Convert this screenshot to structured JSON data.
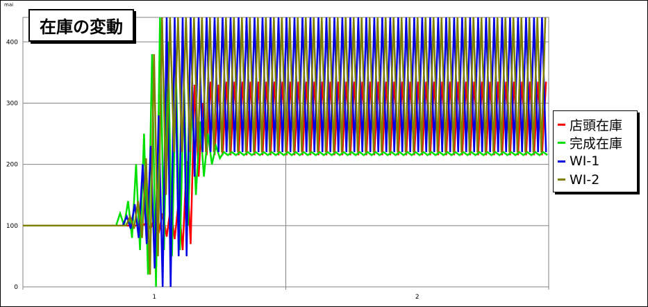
{
  "chart_data": {
    "type": "line",
    "title": "在庫の変動",
    "ylabel": "mai",
    "xlabel": "",
    "ylim": [
      0,
      440
    ],
    "yticks": [
      0,
      100,
      200,
      300,
      400
    ],
    "xticks": [
      "1",
      "2"
    ],
    "grid": true,
    "legend_position": "right",
    "series": [
      {
        "name": "店頭在庫",
        "color": "#ff0000",
        "x": [
          0,
          164,
          180,
          186,
          192,
          198,
          204,
          210,
          216,
          222,
          228,
          234,
          240,
          246,
          252,
          258,
          264,
          270,
          276,
          282,
          288,
          294,
          300,
          306,
          312,
          318,
          324,
          330,
          336,
          342,
          348,
          354
        ],
        "values": [
          100,
          100,
          100,
          105,
          95,
          112,
          88,
          120,
          82,
          130,
          78,
          140,
          60,
          205,
          70,
          330,
          180,
          300,
          215,
          335,
          215,
          330,
          215,
          335,
          215,
          335,
          215,
          335,
          215,
          335,
          215,
          335
        ]
      },
      {
        "name": "完成在庫",
        "color": "#00e000",
        "x": [
          0,
          140,
          146,
          152,
          158,
          164,
          170,
          176,
          182,
          188,
          194,
          200,
          206,
          212,
          218,
          224,
          230,
          236,
          242,
          248,
          254,
          260,
          266,
          272,
          278,
          284,
          290,
          296,
          302,
          308
        ],
        "values": [
          100,
          100,
          120,
          100,
          140,
          80,
          200,
          60,
          250,
          20,
          380,
          0,
          440,
          60,
          400,
          50,
          350,
          60,
          330,
          100,
          300,
          150,
          270,
          180,
          250,
          200,
          230,
          210,
          220,
          215
        ]
      },
      {
        "name": "WI-1",
        "color": "#0000e0",
        "x": [
          0,
          150,
          156,
          162,
          168,
          174,
          180,
          186,
          192,
          198,
          204,
          210,
          216,
          222,
          228,
          234,
          240,
          246,
          252,
          258,
          264,
          270,
          276,
          282,
          288,
          294,
          300,
          306,
          312,
          318,
          324,
          330,
          336,
          342,
          348,
          354
        ],
        "values": [
          100,
          100,
          115,
          95,
          135,
          80,
          200,
          70,
          230,
          30,
          280,
          0,
          440,
          0,
          440,
          50,
          440,
          50,
          440,
          180,
          440,
          220,
          440,
          220,
          440,
          220,
          440,
          220,
          440,
          220,
          440,
          220,
          440,
          220,
          440,
          220
        ]
      },
      {
        "name": "WI-2",
        "color": "#808000",
        "x": [
          0,
          155,
          161,
          167,
          173,
          179,
          185,
          191,
          197,
          203,
          209,
          215,
          221,
          227,
          233,
          239,
          245,
          251,
          257,
          263,
          269,
          275,
          281,
          287,
          293,
          299,
          305,
          311,
          317,
          323,
          329,
          335,
          341,
          347,
          353
        ],
        "values": [
          100,
          100,
          115,
          95,
          140,
          80,
          210,
          20,
          380,
          50,
          440,
          150,
          440,
          220,
          440,
          220,
          440,
          220,
          440,
          220,
          440,
          220,
          440,
          220,
          440,
          220,
          440,
          220,
          440,
          220,
          440,
          220,
          440,
          220,
          440
        ]
      }
    ]
  }
}
